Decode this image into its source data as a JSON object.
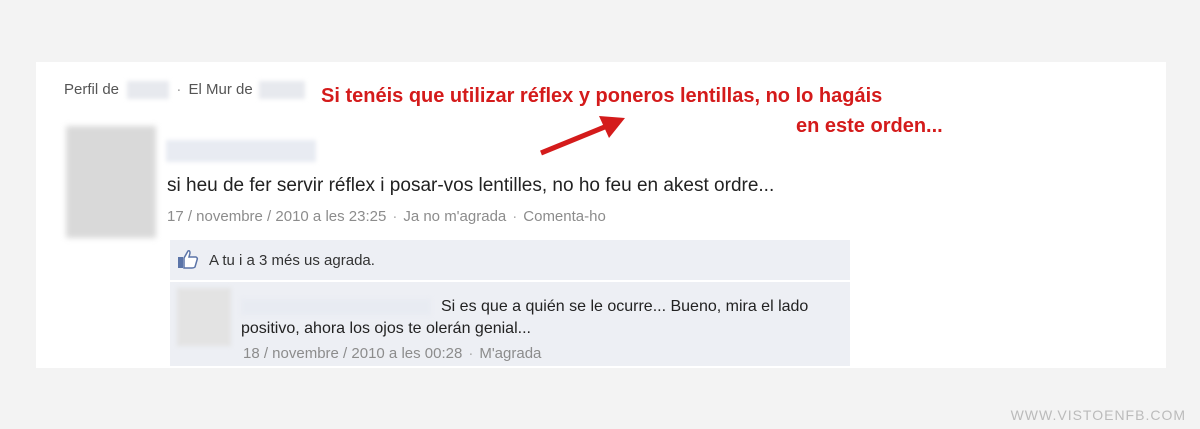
{
  "header": {
    "profile_prefix": "Perfil de",
    "wall_prefix": "El Mur de",
    "separator": "·"
  },
  "annotation": {
    "line1": "Si tenéis que utilizar réflex y poneros lentillas, no lo hagáis",
    "line2": "en este orden...",
    "color": "#d41b1b"
  },
  "post": {
    "text": "si heu de fer servir réflex i posar-vos lentilles, no ho feu en akest ordre...",
    "timestamp": "17 / novembre / 2010 a les 23:25",
    "unlike_label": "Ja no m'agrada",
    "comment_label": "Comenta-ho"
  },
  "likes": {
    "text": "A tu i a 3 més us agrada."
  },
  "comment": {
    "text": "Si es que a quién se le ocurre... Bueno, mira el lado positivo, ahora los ojos te olerán genial...",
    "timestamp": "18 / novembre / 2010 a les 00:28",
    "like_label": "M'agrada"
  },
  "watermark": "WWW.VISTOENFB.COM",
  "icons": {
    "thumb": "thumbs-up-icon",
    "arrow": "arrow-icon"
  }
}
